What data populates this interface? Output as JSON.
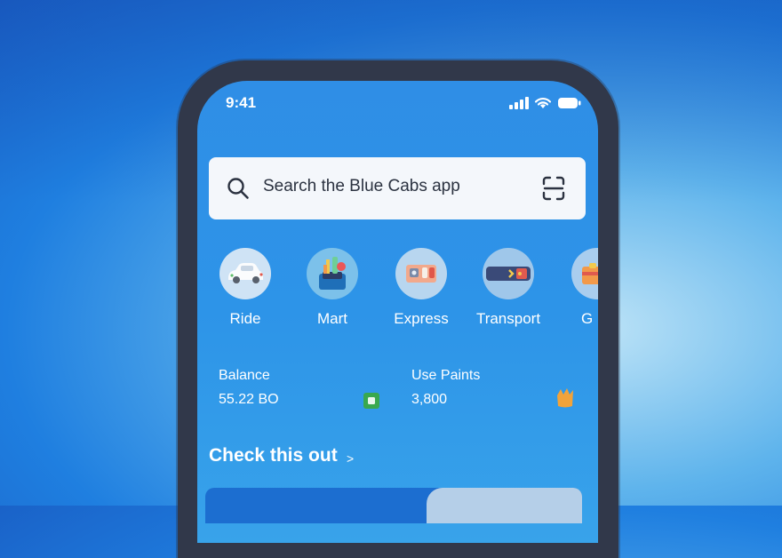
{
  "status_bar": {
    "time": "9:41"
  },
  "search": {
    "placeholder": "Search the Blue Cabs app"
  },
  "services": [
    {
      "label": "Ride",
      "icon": "car-icon"
    },
    {
      "label": "Mart",
      "icon": "grocery-bag-icon"
    },
    {
      "label": "Express",
      "icon": "parcel-icon"
    },
    {
      "label": "Transport",
      "icon": "ticket-icon"
    },
    {
      "label": "G",
      "icon": "gift-icon"
    }
  ],
  "wallet": {
    "balance_label": "Balance",
    "balance_value": "55.22 BO",
    "points_label": "Use Paints",
    "points_value": "3,800"
  },
  "promo": {
    "title": "Check this out",
    "chevron": ">"
  },
  "colors": {
    "brand_blue": "#2d94e8",
    "phone_frame": "#31384a"
  }
}
